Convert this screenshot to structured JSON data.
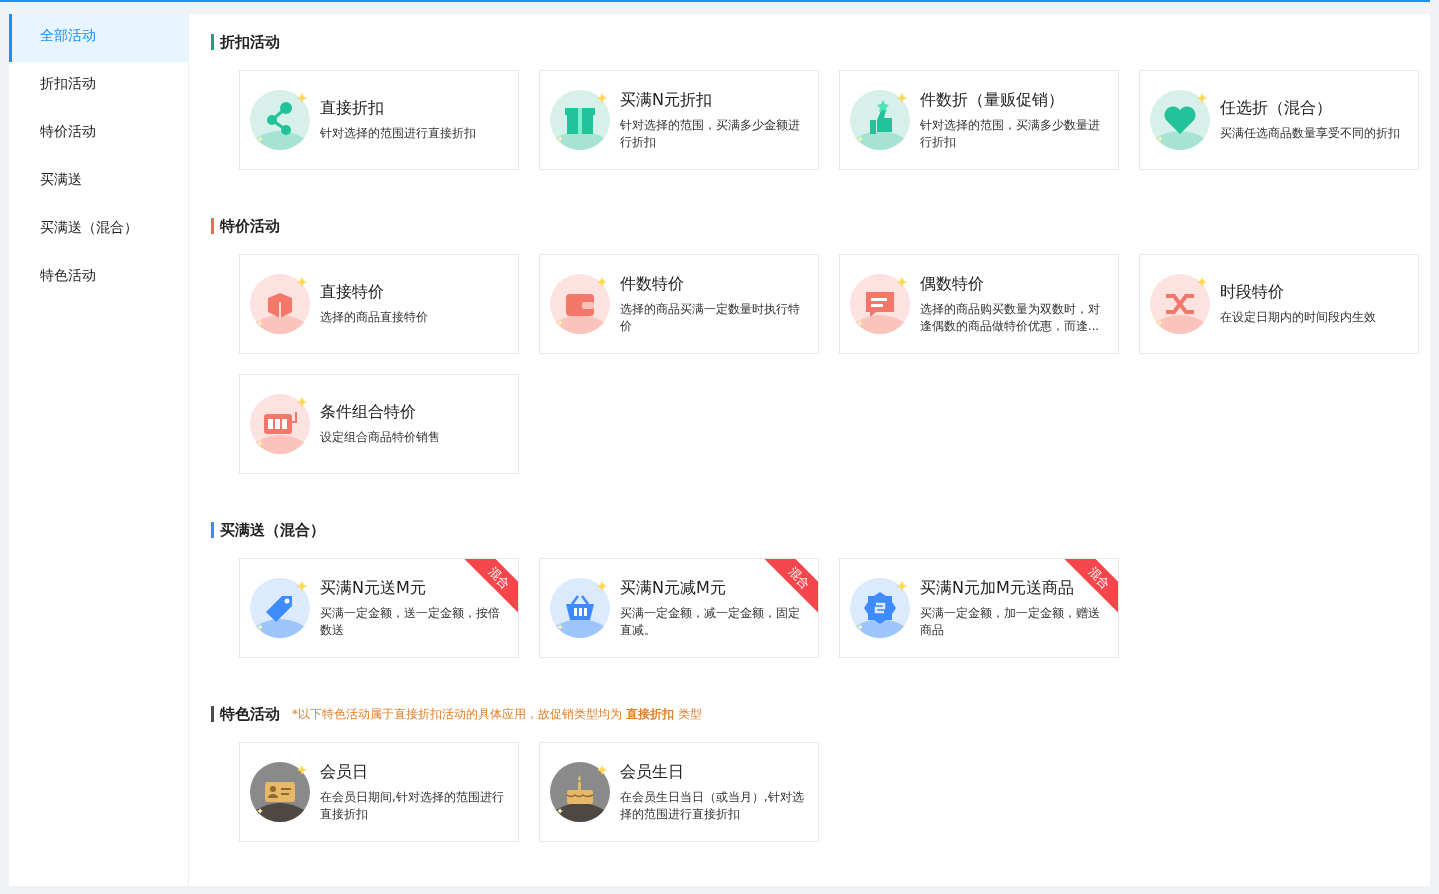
{
  "sidebar": {
    "items": [
      {
        "label": "全部活动",
        "selected": true
      },
      {
        "label": "折扣活动",
        "selected": false
      },
      {
        "label": "特价活动",
        "selected": false
      },
      {
        "label": "买满送",
        "selected": false
      },
      {
        "label": "买满送（混合）",
        "selected": false
      },
      {
        "label": "特色活动",
        "selected": false
      }
    ]
  },
  "sections": [
    {
      "title": "折扣活动",
      "color": "#1aa57a",
      "cards": [
        {
          "title": "直接折扣",
          "desc": "针对选择的范围进行直接折扣"
        },
        {
          "title": "买满N元折扣",
          "desc": "针对选择的范围，买满多少金额进行折扣"
        },
        {
          "title": "件数折（量贩促销）",
          "desc": "针对选择的范围，买满多少数量进行折扣"
        },
        {
          "title": "任选折（混合）",
          "desc": "买满任选商品数量享受不同的折扣"
        }
      ]
    },
    {
      "title": "特价活动",
      "color": "#f06a5a",
      "cards": [
        {
          "title": "直接特价",
          "desc": "选择的商品直接特价"
        },
        {
          "title": "件数特价",
          "desc": "选择的商品买满一定数量时执行特价"
        },
        {
          "title": "偶数特价",
          "desc": "选择的商品购买数量为双数时，对逢偶数的商品做特价优惠，而逢..."
        },
        {
          "title": "时段特价",
          "desc": "在设定日期内的时间段内生效"
        },
        {
          "title": "条件组合特价",
          "desc": "设定组合商品特价销售"
        }
      ]
    },
    {
      "title": "买满送（混合）",
      "color": "#3d8bfd",
      "cards": [
        {
          "title": "买满N元送M元",
          "desc": "买满一定金额，送一定金额，按倍数送",
          "badge": "混合"
        },
        {
          "title": "买满N元减M元",
          "desc": "买满一定金额，减一定金额，固定直减。",
          "badge": "混合"
        },
        {
          "title": "买满N元加M元送商品",
          "desc": "买满一定金额，加一定金额，赠送商品",
          "badge": "混合"
        }
      ]
    },
    {
      "title": "特色活动",
      "color": "#4a4a4a",
      "note": "*以下特色活动属于直接折扣活动的具体应用，故促销类型均为 **直接折扣** 类型",
      "cards": [
        {
          "title": "会员日",
          "desc": "在会员日期间,针对选择的范围进行直接折扣"
        },
        {
          "title": "会员生日",
          "desc": "在会员生日当日（或当月）,针对选择的范围进行直接折扣"
        }
      ]
    }
  ]
}
